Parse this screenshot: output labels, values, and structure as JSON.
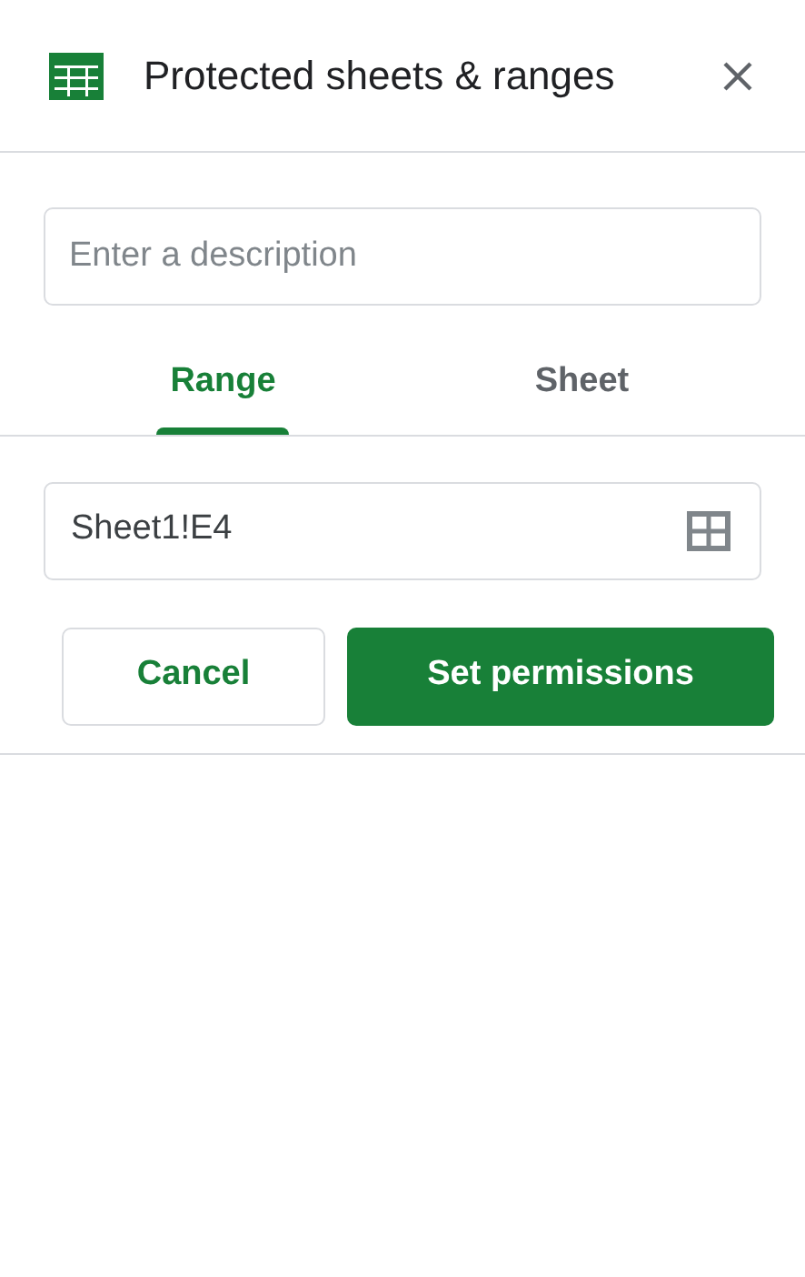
{
  "panel": {
    "title": "Protected sheets & ranges"
  },
  "description": {
    "placeholder": "Enter a description"
  },
  "tabs": [
    {
      "label": "Range",
      "selected": true
    },
    {
      "label": "Sheet",
      "selected": false
    }
  ],
  "range": {
    "value": "Sheet1!E4"
  },
  "buttons": {
    "cancel": "Cancel",
    "confirm": "Set permissions"
  }
}
